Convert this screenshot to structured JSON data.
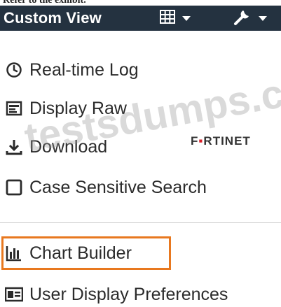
{
  "caption": "Refer to the exhibit.",
  "toolbar": {
    "title": "Custom View",
    "grid_button_icon": "grid-icon",
    "wrench_button_icon": "wrench-icon"
  },
  "menu": {
    "items": [
      {
        "label": "Real-time Log",
        "icon": "clock-icon"
      },
      {
        "label": "Display Raw",
        "icon": "raw-log-icon"
      },
      {
        "label": "Download",
        "icon": "download-icon"
      },
      {
        "label": "Case Sensitive Search",
        "icon": "checkbox-icon"
      },
      {
        "label": "Chart Builder",
        "icon": "bar-chart-icon"
      },
      {
        "label": "User Display Preferences",
        "icon": "id-card-icon"
      }
    ]
  },
  "brand": {
    "text_pre": "F",
    "text_accent": "▪",
    "text_post": "RTINET"
  },
  "watermark": "testsdumps.com",
  "colors": {
    "toolbar_bg": "#243240",
    "highlight": "#e8781f",
    "brand_accent": "#d8202a"
  }
}
